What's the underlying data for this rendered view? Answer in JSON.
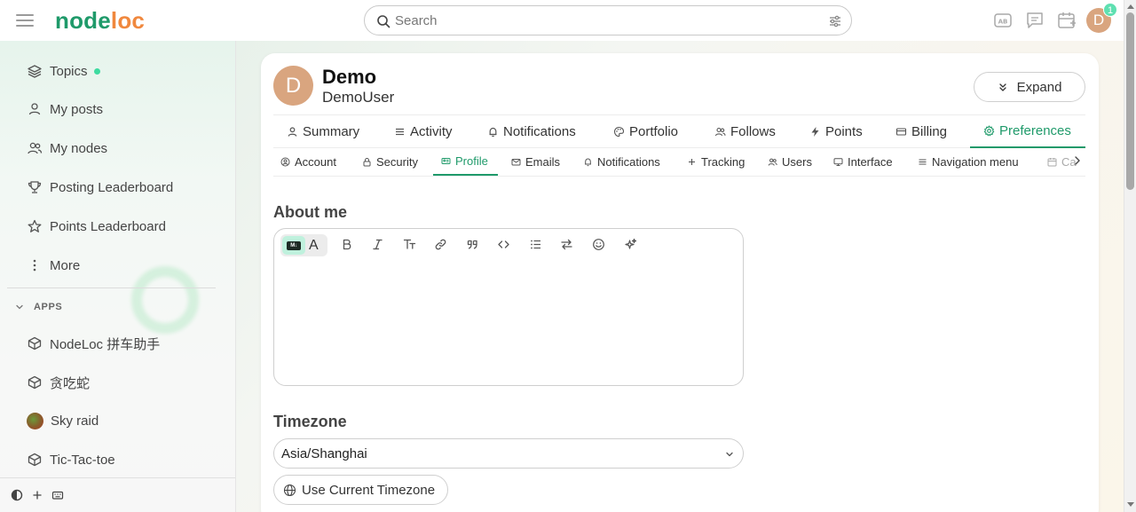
{
  "header": {
    "logo_part1": "node",
    "logo_part2": "loc",
    "search_placeholder": "Search",
    "avatar_letter": "D",
    "notification_count": "1"
  },
  "sidebar": {
    "items": [
      {
        "label": "Topics",
        "icon": "layers-icon"
      },
      {
        "label": "My posts",
        "icon": "user-icon"
      },
      {
        "label": "My nodes",
        "icon": "users-icon"
      },
      {
        "label": "Posting Leaderboard",
        "icon": "trophy-icon"
      },
      {
        "label": "Points Leaderboard",
        "icon": "star-icon"
      },
      {
        "label": "More",
        "icon": "dots-vertical-icon"
      }
    ],
    "apps_header": "APPS",
    "apps": [
      {
        "label": "NodeLoc 拼车助手",
        "icon": "cube-icon"
      },
      {
        "label": "贪吃蛇",
        "icon": "cube-icon"
      },
      {
        "label": "Sky raid",
        "icon": "sky-raid-icon"
      },
      {
        "label": "Tic-Tac-toe",
        "icon": "cube-icon"
      }
    ]
  },
  "profile": {
    "avatar_letter": "D",
    "name": "Demo",
    "username": "DemoUser",
    "expand_label": "Expand"
  },
  "tabs_primary": [
    {
      "label": "Summary",
      "icon": "user-icon"
    },
    {
      "label": "Activity",
      "icon": "list-icon"
    },
    {
      "label": "Notifications",
      "icon": "bell-icon"
    },
    {
      "label": "Portfolio",
      "icon": "palette-icon"
    },
    {
      "label": "Follows",
      "icon": "users-icon"
    },
    {
      "label": "Points",
      "icon": "bolt-icon"
    },
    {
      "label": "Billing",
      "icon": "card-icon"
    },
    {
      "label": "Preferences",
      "icon": "gear-icon",
      "active": true
    }
  ],
  "tabs_secondary": [
    {
      "label": "Account",
      "icon": "user-circle-icon"
    },
    {
      "label": "Security",
      "icon": "lock-icon"
    },
    {
      "label": "Profile",
      "icon": "id-card-icon",
      "active": true
    },
    {
      "label": "Emails",
      "icon": "mail-icon"
    },
    {
      "label": "Notifications",
      "icon": "bell-icon"
    },
    {
      "label": "Tracking",
      "icon": "plus-icon"
    },
    {
      "label": "Users",
      "icon": "users-icon"
    },
    {
      "label": "Interface",
      "icon": "monitor-icon"
    },
    {
      "label": "Navigation menu",
      "icon": "list-icon"
    },
    {
      "label": "Ca",
      "icon": "calendar-icon"
    }
  ],
  "about": {
    "title": "About me",
    "md_badge": "M↓",
    "rich_text_glyph": "A"
  },
  "timezone": {
    "title": "Timezone",
    "value": "Asia/Shanghai",
    "button_label": "Use Current Timezone"
  },
  "colors": {
    "accent": "#1f9a6a",
    "logo_orange": "#f0883e",
    "avatar": "#d9a57f",
    "badge": "#5fe0b1"
  }
}
